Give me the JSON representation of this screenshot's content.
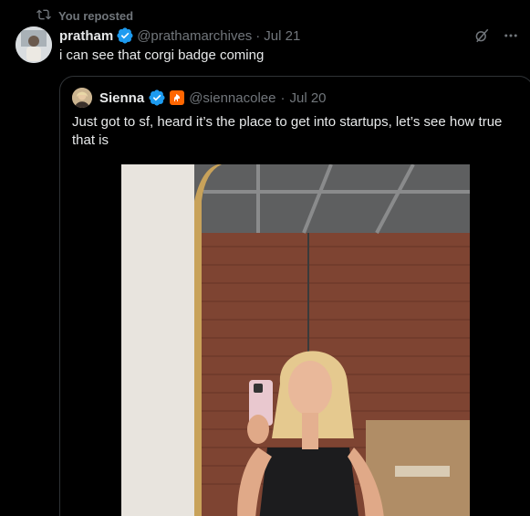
{
  "repost": {
    "label": "You reposted",
    "icon": "repost-icon"
  },
  "tweet": {
    "author_name": "pratham",
    "author_handle": "@prathamarchives",
    "separator": "·",
    "date": "Jul 21",
    "text": "i can see that corgi badge coming",
    "icons": [
      "verified-icon",
      "grok-icon",
      "more-icon"
    ]
  },
  "quoted_tweet": {
    "author_name": "Sienna",
    "author_handle": "@siennacolee",
    "separator": "·",
    "date": "Jul 20",
    "text": "Just got to sf, heard it’s the place to get into startups, let’s see how true that is",
    "icons": [
      "verified-icon",
      "affiliate-badge-icon"
    ]
  },
  "colors": {
    "background": "#000000",
    "text": "#e7e9ea",
    "muted": "#71767b",
    "verified": "#1d9bf0",
    "border": "#2f3336",
    "affiliate_badge": "#ff6600"
  }
}
